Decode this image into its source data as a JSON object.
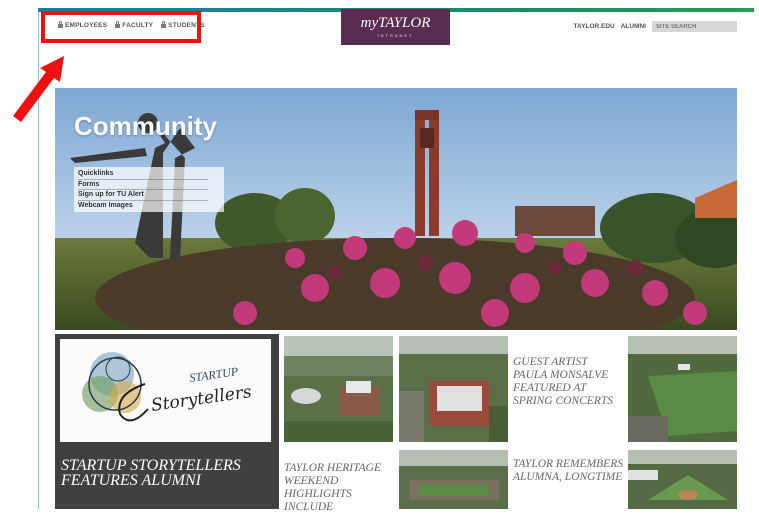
{
  "header": {
    "audience_links": [
      "EMPLOYEES",
      "FACULTY",
      "STUDENTS"
    ],
    "logo_brand": "myTAYLOR",
    "logo_sub": "INTRANET",
    "utility_links": [
      "TAYLOR.EDU",
      "ALUMNI"
    ],
    "search_placeholder": "SITE SEARCH"
  },
  "hero": {
    "title": "Community",
    "quicklinks": [
      "Quicklinks",
      "Forms",
      "Sign up for TU Alert",
      "Webcam Images"
    ]
  },
  "feature": {
    "logo_text_top": "STARTUP",
    "logo_text_script": "Storytellers",
    "caption": "STARTUP STORYTELLERS FEATURES ALUMNI"
  },
  "news": [
    "GUEST ARTIST PAULA MONSALVE FEATURED AT SPRING CONCERTS",
    "TAYLOR HERITAGE WEEKEND HIGHLIGHTS INCLUDE",
    "TAYLOR REMEMBERS ALUMNA, LONGTIME"
  ],
  "colors": {
    "accent_bar": "#1d7aa8",
    "logo_bg": "#5b2c52",
    "highlight": "#ee1111",
    "feature_bg": "#404040"
  }
}
